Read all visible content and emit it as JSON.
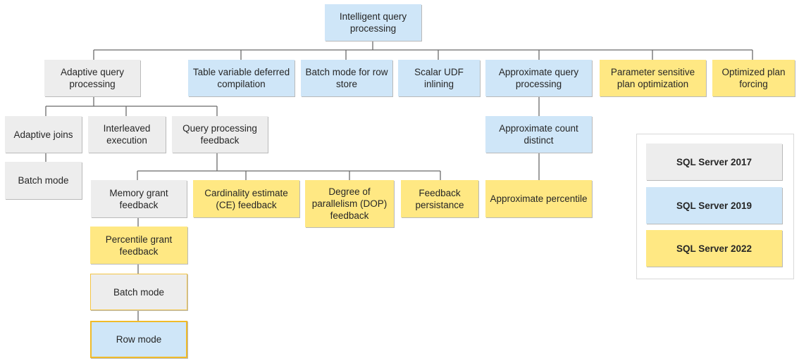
{
  "diagram": {
    "title_node": "Intelligent query processing",
    "legend": {
      "items": [
        {
          "label": "SQL Server 2017",
          "color": "#ededed"
        },
        {
          "label": "SQL Server 2019",
          "color": "#cfe6f8"
        },
        {
          "label": "SQL Server 2022",
          "color": "#ffe883"
        }
      ]
    },
    "nodes": {
      "root": {
        "label": "Intelligent query processing",
        "version": "SQL Server 2019"
      },
      "adaptive_qp": {
        "label": "Adaptive query processing",
        "version": "SQL Server 2017"
      },
      "table_var": {
        "label": "Table variable deferred compilation",
        "version": "SQL Server 2019"
      },
      "batch_rowstore": {
        "label": "Batch mode for row store",
        "version": "SQL Server 2019"
      },
      "scalar_udf": {
        "label": "Scalar UDF inlining",
        "version": "SQL Server 2019"
      },
      "approx_qp": {
        "label": "Approximate query processing",
        "version": "SQL Server 2019"
      },
      "psp": {
        "label": "Parameter sensitive plan optimization",
        "version": "SQL Server 2022"
      },
      "opf": {
        "label": "Optimized plan forcing",
        "version": "SQL Server 2022"
      },
      "adaptive_joins": {
        "label": "Adaptive joins",
        "version": "SQL Server 2017"
      },
      "aj_batch": {
        "label": "Batch mode",
        "version": "SQL Server 2017"
      },
      "interleaved": {
        "label": "Interleaved execution",
        "version": "SQL Server 2017"
      },
      "qp_feedback": {
        "label": "Query processing feedback",
        "version": "SQL Server 2017"
      },
      "memory_grant": {
        "label": "Memory grant feedback",
        "version": "SQL Server 2017"
      },
      "percentile_grant": {
        "label": "Percentile grant feedback",
        "version": "SQL Server 2022"
      },
      "mg_batch": {
        "label": "Batch mode",
        "version": "SQL Server 2017"
      },
      "mg_row": {
        "label": "Row mode",
        "version": "SQL Server 2019"
      },
      "ce_feedback": {
        "label": "Cardinality estimate (CE) feedback",
        "version": "SQL Server 2022"
      },
      "dop_feedback": {
        "label": "Degree of parallelism (DOP) feedback",
        "version": "SQL Server 2022"
      },
      "feedback_persist": {
        "label": "Feedback persistance",
        "version": "SQL Server 2022"
      },
      "approx_count": {
        "label": "Approximate count distinct",
        "version": "SQL Server 2019"
      },
      "approx_pct": {
        "label": "Approximate percentile",
        "version": "SQL Server 2022"
      }
    },
    "edges": [
      [
        "root",
        "adaptive_qp"
      ],
      [
        "root",
        "table_var"
      ],
      [
        "root",
        "batch_rowstore"
      ],
      [
        "root",
        "scalar_udf"
      ],
      [
        "root",
        "approx_qp"
      ],
      [
        "root",
        "psp"
      ],
      [
        "root",
        "opf"
      ],
      [
        "adaptive_qp",
        "adaptive_joins"
      ],
      [
        "adaptive_qp",
        "interleaved"
      ],
      [
        "adaptive_qp",
        "qp_feedback"
      ],
      [
        "adaptive_joins",
        "aj_batch"
      ],
      [
        "qp_feedback",
        "memory_grant"
      ],
      [
        "qp_feedback",
        "ce_feedback"
      ],
      [
        "qp_feedback",
        "dop_feedback"
      ],
      [
        "qp_feedback",
        "feedback_persist"
      ],
      [
        "memory_grant",
        "percentile_grant"
      ],
      [
        "percentile_grant",
        "mg_batch"
      ],
      [
        "mg_batch",
        "mg_row"
      ],
      [
        "approx_qp",
        "approx_count"
      ],
      [
        "approx_count",
        "approx_pct"
      ]
    ]
  }
}
